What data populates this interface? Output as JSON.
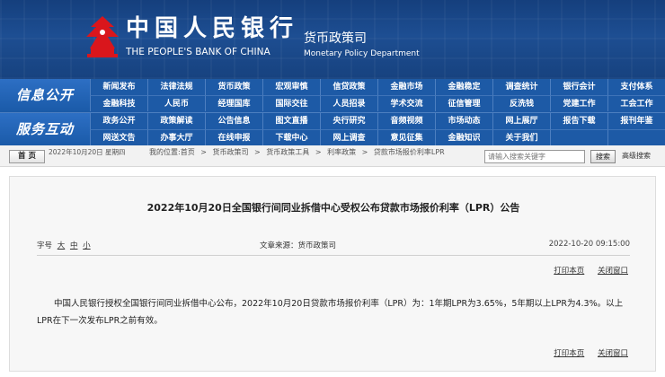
{
  "header": {
    "bank_name_cn": "中国人民银行",
    "bank_name_en": "THE PEOPLE'S BANK OF CHINA",
    "dept_cn": "货币政策司",
    "dept_en": "Monetary Policy Department"
  },
  "nav": {
    "groups": [
      {
        "title": "信息公开",
        "row1": [
          "新闻发布",
          "法律法规",
          "货币政策",
          "宏观审慎",
          "信贷政策",
          "金融市场",
          "金融稳定",
          "调查统计",
          "银行会计",
          "支付体系"
        ],
        "row2": [
          "金融科技",
          "人民币",
          "经理国库",
          "国际交往",
          "人员招录",
          "学术交流",
          "征信管理",
          "反洗钱",
          "党建工作",
          "工会工作"
        ]
      },
      {
        "title": "服务互动",
        "row1": [
          "政务公开",
          "政策解读",
          "公告信息",
          "图文直播",
          "央行研究",
          "音频视频",
          "市场动态",
          "网上展厅",
          "报告下载",
          "报刊年鉴"
        ],
        "row2": [
          "网送文告",
          "办事大厅",
          "在线申报",
          "下载中心",
          "网上调查",
          "意见征集",
          "金融知识",
          "关于我们",
          "",
          ""
        ]
      }
    ]
  },
  "breadcrumb": {
    "home_label": "首 页",
    "date": "2022年10月20日 星期四",
    "trail": [
      "我的位置:首页",
      ">",
      "货币政策司",
      ">",
      "货币政策工具",
      ">",
      "利率政策",
      ">",
      "贷款市场报价利率LPR"
    ],
    "search_placeholder": "请输入搜索关键字",
    "search_label": "搜索",
    "advanced_search_label": "高级搜索"
  },
  "article": {
    "title": "2022年10月20日全国银行间同业拆借中心受权公布贷款市场报价利率（LPR）公告",
    "font_label": "字号",
    "font_sizes": [
      "大",
      "中",
      "小"
    ],
    "source": "文章来源：货币政策司",
    "pub_time": "2022-10-20 09:15:00",
    "print_label": "打印本页",
    "close_label": "关闭窗口",
    "body": "中国人民银行授权全国银行间同业拆借中心公布，2022年10月20日贷款市场报价利率（LPR）为：1年期LPR为3.65%，5年期以上LPR为4.3%。以上LPR在下一次发布LPR之前有效。"
  },
  "colors": {
    "banner": "#1d4e92",
    "nav": "#1d5aa6",
    "emblem": "#d9161c"
  }
}
